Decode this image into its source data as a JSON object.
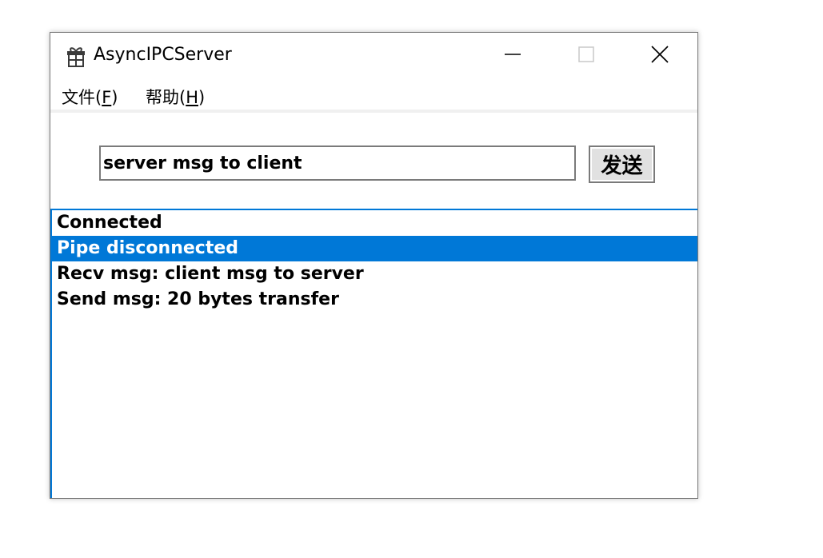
{
  "window": {
    "title": "AsyncIPCServer",
    "icon": "gift-icon"
  },
  "controls": {
    "minimize_icon": "minimize-icon",
    "maximize_icon": "maximize-icon",
    "close_icon": "close-icon"
  },
  "menu": {
    "file_label": "文件(",
    "file_key": "F",
    "help_label": "帮助(",
    "help_key": "H",
    "close_paren": ")"
  },
  "composer": {
    "input_value": "server msg to client",
    "send_label": "发送"
  },
  "log": {
    "items": [
      "Connected",
      "Pipe disconnected",
      "Recv msg: client msg to server",
      "Send msg: 20 bytes transfer"
    ],
    "selected_index": 1
  },
  "colors": {
    "selection": "#0078d7",
    "border": "#7a7a7a",
    "button_face": "#e1e1e1"
  }
}
